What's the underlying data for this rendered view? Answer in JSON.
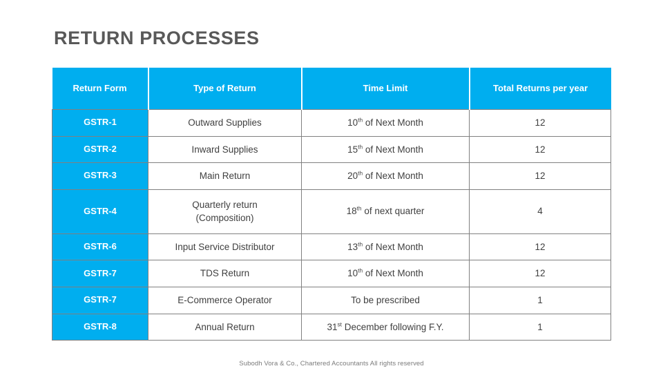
{
  "slide": {
    "title": "RETURN PROCESSES",
    "footer": "Subodh Vora & Co., Chartered Accountants  All rights reserved",
    "accent_color": "#00AEEF",
    "title_color": "#595959",
    "border_color": "#808080",
    "body_text_color": "#3f3f3f"
  },
  "table": {
    "headers": [
      "Return Form",
      "Type of Return",
      "Time Limit",
      "Total Returns per year"
    ],
    "rows": [
      {
        "return_form": "GSTR-1",
        "type_of_return": "Outward Supplies",
        "time_limit_number": "10",
        "time_limit_ordinal": "th",
        "time_limit_rest": " of Next Month",
        "total_returns": "12"
      },
      {
        "return_form": "GSTR-2",
        "type_of_return": "Inward Supplies",
        "time_limit_number": "15",
        "time_limit_ordinal": "th",
        "time_limit_rest": " of Next Month",
        "total_returns": "12"
      },
      {
        "return_form": "GSTR-3",
        "type_of_return": "Main Return",
        "time_limit_number": "20",
        "time_limit_ordinal": "th",
        "time_limit_rest": " of Next Month",
        "total_returns": "12"
      },
      {
        "return_form": "GSTR-4",
        "type_of_return": "Quarterly return",
        "type_of_return_line2": "(Composition)",
        "time_limit_number": "18",
        "time_limit_ordinal": "th",
        "time_limit_rest": " of next quarter",
        "total_returns": "4"
      },
      {
        "return_form": "GSTR-6",
        "type_of_return": "Input Service Distributor",
        "time_limit_number": "13",
        "time_limit_ordinal": "th",
        "time_limit_rest": " of Next Month",
        "total_returns": "12"
      },
      {
        "return_form": "GSTR-7",
        "type_of_return": "TDS Return",
        "time_limit_number": "10",
        "time_limit_ordinal": "th",
        "time_limit_rest": " of Next Month",
        "total_returns": "12"
      },
      {
        "return_form": "GSTR-7",
        "type_of_return": "E-Commerce Operator",
        "time_limit_number": "",
        "time_limit_ordinal": "",
        "time_limit_rest": "To be prescribed",
        "total_returns": "1"
      },
      {
        "return_form": "GSTR-8",
        "type_of_return": "Annual Return",
        "time_limit_number": "31",
        "time_limit_ordinal": "st",
        "time_limit_rest": " December following F.Y.",
        "total_returns": "1"
      }
    ]
  }
}
